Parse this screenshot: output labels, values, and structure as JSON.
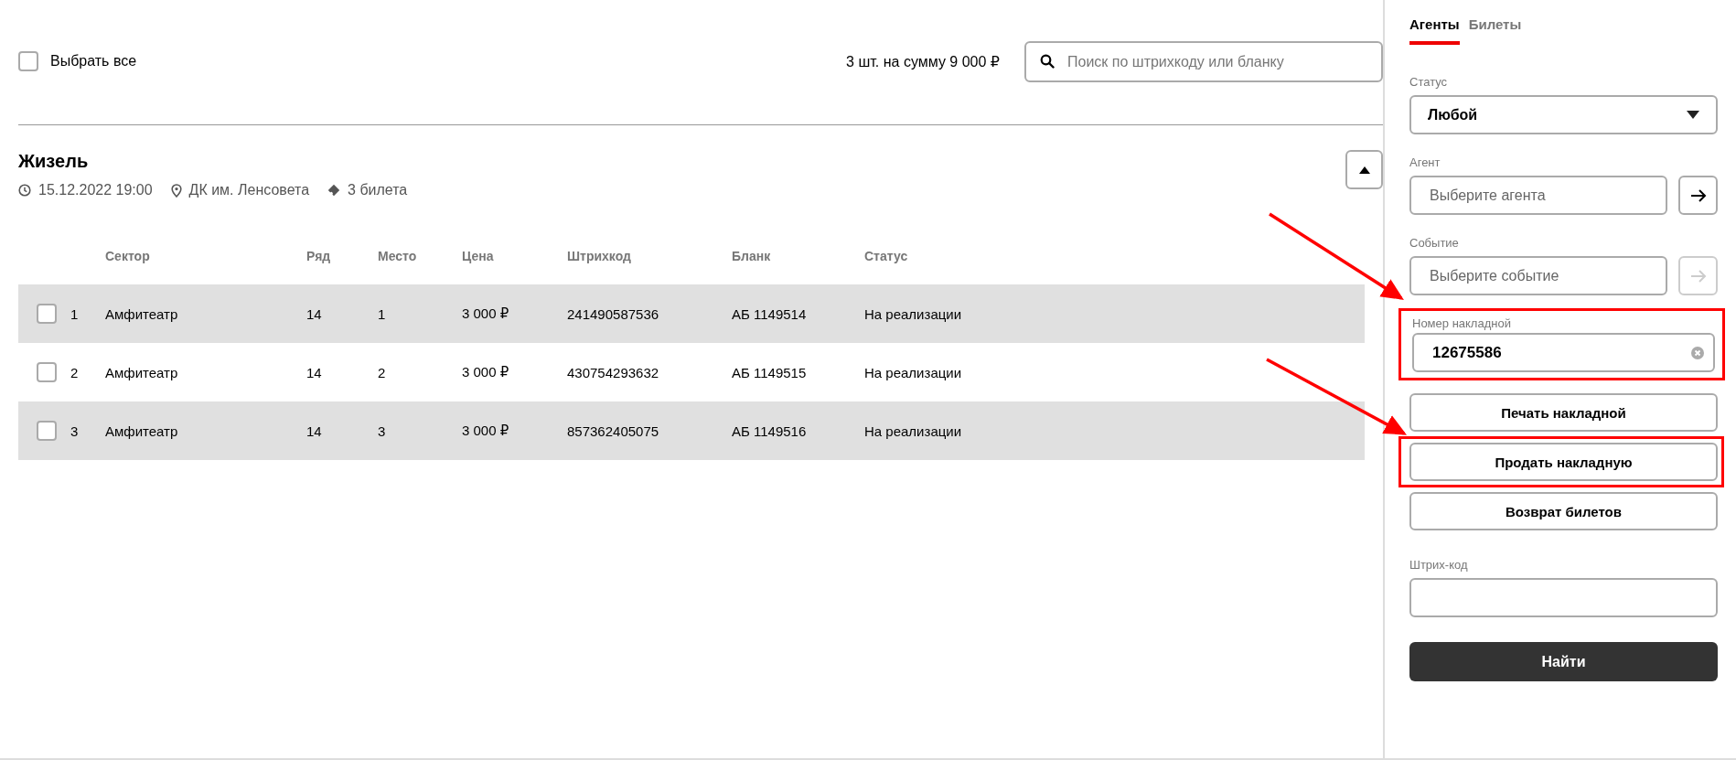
{
  "toolbar": {
    "select_all": {
      "label": "Выбрать все",
      "checked": false
    },
    "summary": "3 шт. на сумму 9 000 ₽",
    "search": {
      "placeholder": "Поиск по штрихкоду или бланку"
    }
  },
  "event": {
    "title": "Жизель",
    "datetime": "15.12.2022 19:00",
    "venue": "ДК им. Ленсовета",
    "tickets": "3 билета",
    "expanded": true
  },
  "table": {
    "columns": [
      "Сектор",
      "Ряд",
      "Место",
      "Цена",
      "Штрихкод",
      "Бланк",
      "Статус"
    ],
    "rows": [
      {
        "number": "1",
        "checked": false,
        "cells": [
          "Амфитеатр",
          "14",
          "1",
          "3 000 ₽",
          "241490587536",
          "АБ 1149514",
          "На реализации"
        ]
      },
      {
        "number": "2",
        "checked": false,
        "cells": [
          "Амфитеатр",
          "14",
          "2",
          "3 000 ₽",
          "430754293632",
          "АБ 1149515",
          "На реализации"
        ]
      },
      {
        "number": "3",
        "checked": false,
        "cells": [
          "Амфитеатр",
          "14",
          "3",
          "3 000 ₽",
          "857362405075",
          "АБ 1149516",
          "На реализации"
        ]
      }
    ]
  },
  "sidebar": {
    "tabs": [
      {
        "label": "Агенты",
        "selected": true
      },
      {
        "label": "Билеты",
        "selected": false
      }
    ],
    "status": {
      "label": "Статус",
      "value": "Любой"
    },
    "agent": {
      "label": "Агент",
      "placeholder": "Выберите агента",
      "go_disabled": false
    },
    "event": {
      "label": "Событие",
      "placeholder": "Выберите событие",
      "go_disabled": true
    },
    "invoice": {
      "label": "Номер накладной",
      "value": "12675586",
      "highlighted": true
    },
    "buttons": [
      {
        "label": "Печать накладной",
        "highlighted": false
      },
      {
        "label": "Продать накладную",
        "highlighted": true
      },
      {
        "label": "Возврат билетов",
        "highlighted": false
      }
    ],
    "barcode": {
      "label": "Штрих-код"
    },
    "find_button": "Найти"
  }
}
